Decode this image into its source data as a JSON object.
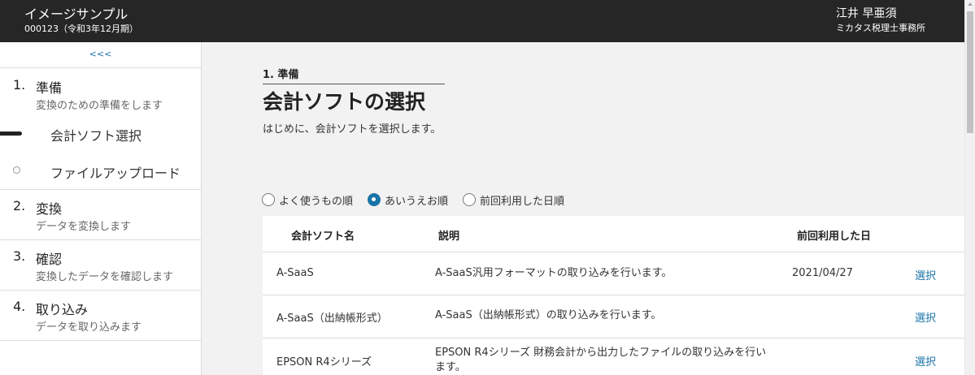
{
  "header": {
    "company": "イメージサンプル",
    "period": "000123（令和3年12月期）",
    "user_name": "江井 早亜須",
    "office_name": "ミカタス税理士事務所"
  },
  "sidebar": {
    "collapse_label": "<<<",
    "steps": [
      {
        "num": "1.",
        "title": "準備",
        "desc": "変換のための準備をします",
        "substeps": [
          {
            "label": "会計ソフト選択",
            "state": "active"
          },
          {
            "label": "ファイルアップロード",
            "state": "pending"
          }
        ]
      },
      {
        "num": "2.",
        "title": "変換",
        "desc": "データを変換します"
      },
      {
        "num": "3.",
        "title": "確認",
        "desc": "変換したデータを確認します"
      },
      {
        "num": "4.",
        "title": "取り込み",
        "desc": "データを取り込みます"
      }
    ]
  },
  "main": {
    "breadcrumb": "1. 準備",
    "title": "会計ソフトの選択",
    "description": "はじめに、会計ソフトを選択します。",
    "sort_options": [
      {
        "label": "よく使うもの順",
        "checked": false
      },
      {
        "label": "あいうえお順",
        "checked": true
      },
      {
        "label": "前回利用した日順",
        "checked": false
      }
    ],
    "table": {
      "headers": [
        "会計ソフト名",
        "説明",
        "前回利用した日"
      ],
      "select_label": "選択",
      "rows": [
        {
          "name": "A-SaaS",
          "desc": "A-SaaS汎用フォーマットの取り込みを行います。",
          "last_used": "2021/04/27"
        },
        {
          "name": "A-SaaS（出納帳形式）",
          "desc": "A-SaaS（出納帳形式）の取り込みを行います。",
          "last_used": ""
        },
        {
          "name": "EPSON R4シリーズ",
          "desc": "EPSON R4シリーズ 財務会計から出力したファイルの取り込みを行います。",
          "last_used": ""
        }
      ]
    }
  },
  "colors": {
    "header_bg": "#262626",
    "accent": "#1a73a8",
    "content_bg": "#f2f2f2"
  },
  "icons": {
    "active_step": "active-bar-indicator",
    "pending_step": "empty-circle-indicator"
  }
}
